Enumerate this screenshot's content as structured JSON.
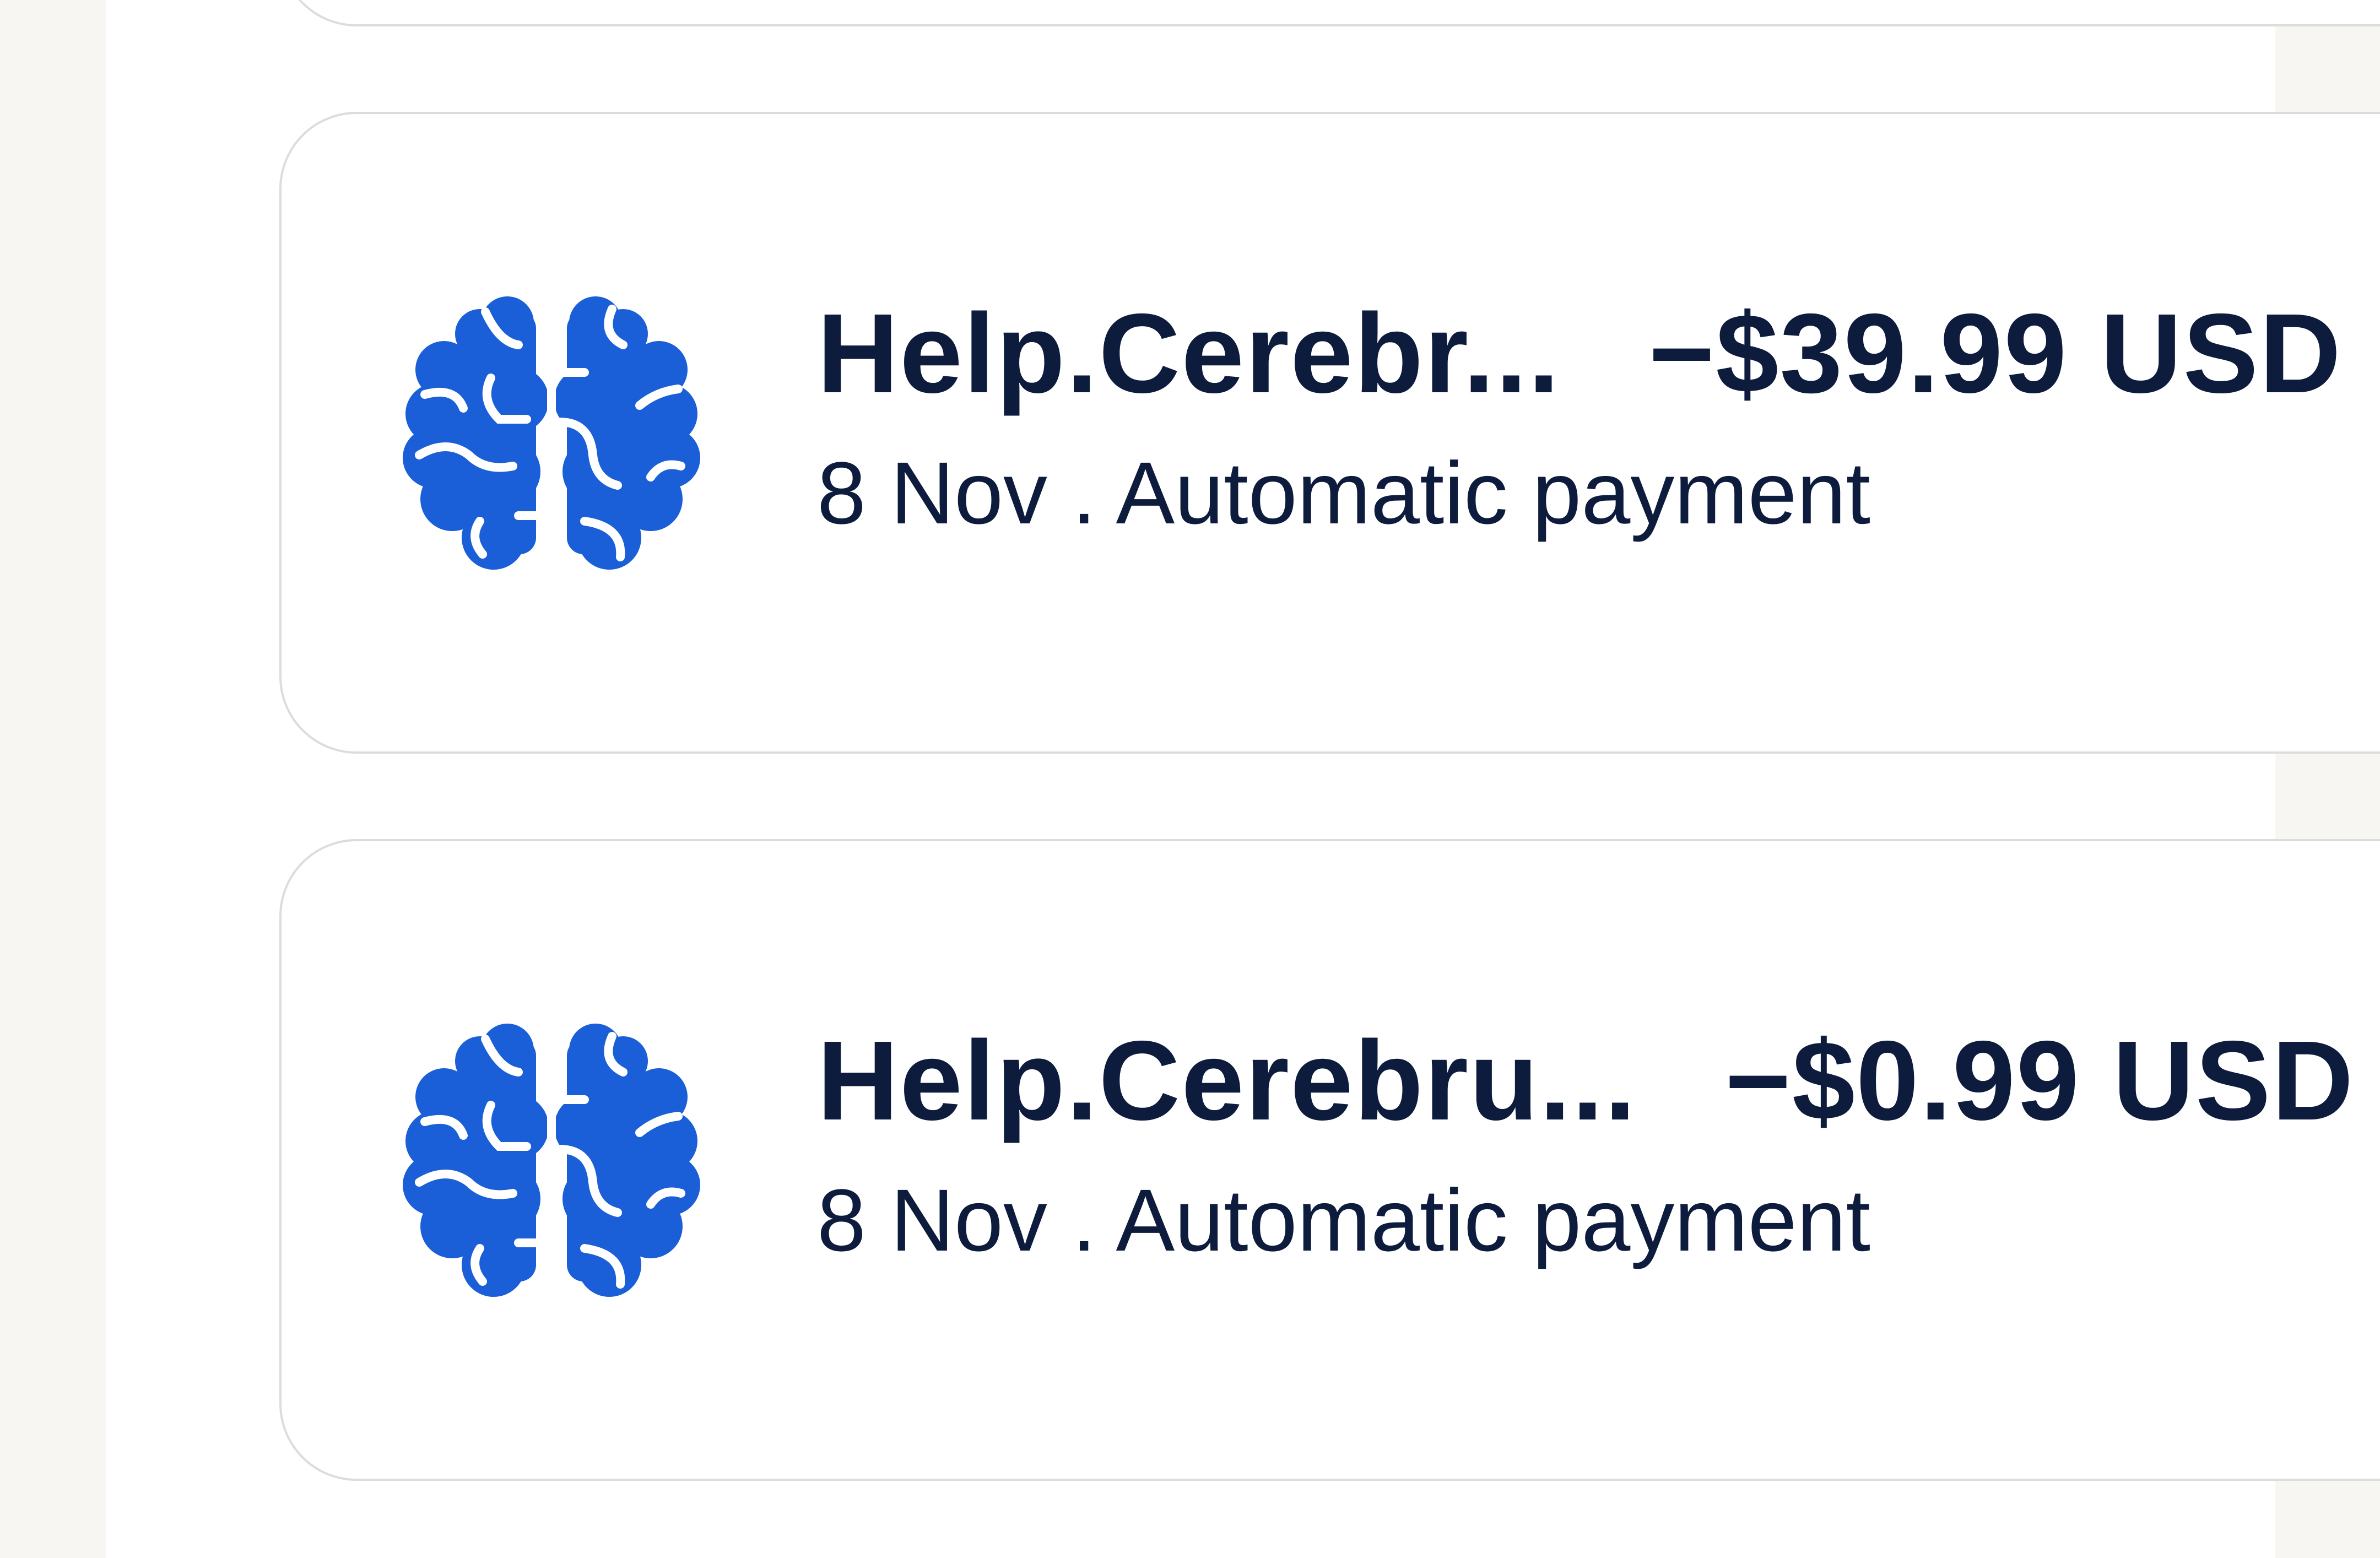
{
  "transactions": [
    {
      "merchant": "Help.Cerebr...",
      "amount": "−$39.99 USD",
      "date": "8 Nov",
      "separator": ".",
      "type": "Automatic payment",
      "icon": "brain-icon",
      "icon_color": "#1a5ed8"
    },
    {
      "merchant": "Help.Cerebru...",
      "amount": "−$0.99 USD",
      "date": "8 Nov",
      "separator": ".",
      "type": "Automatic payment",
      "icon": "brain-icon",
      "icon_color": "#1a5ed8"
    }
  ],
  "colors": {
    "background": "#f7f6f2",
    "card": "#ffffff",
    "text": "#0d1b3d",
    "accent": "#1a5ed8"
  }
}
